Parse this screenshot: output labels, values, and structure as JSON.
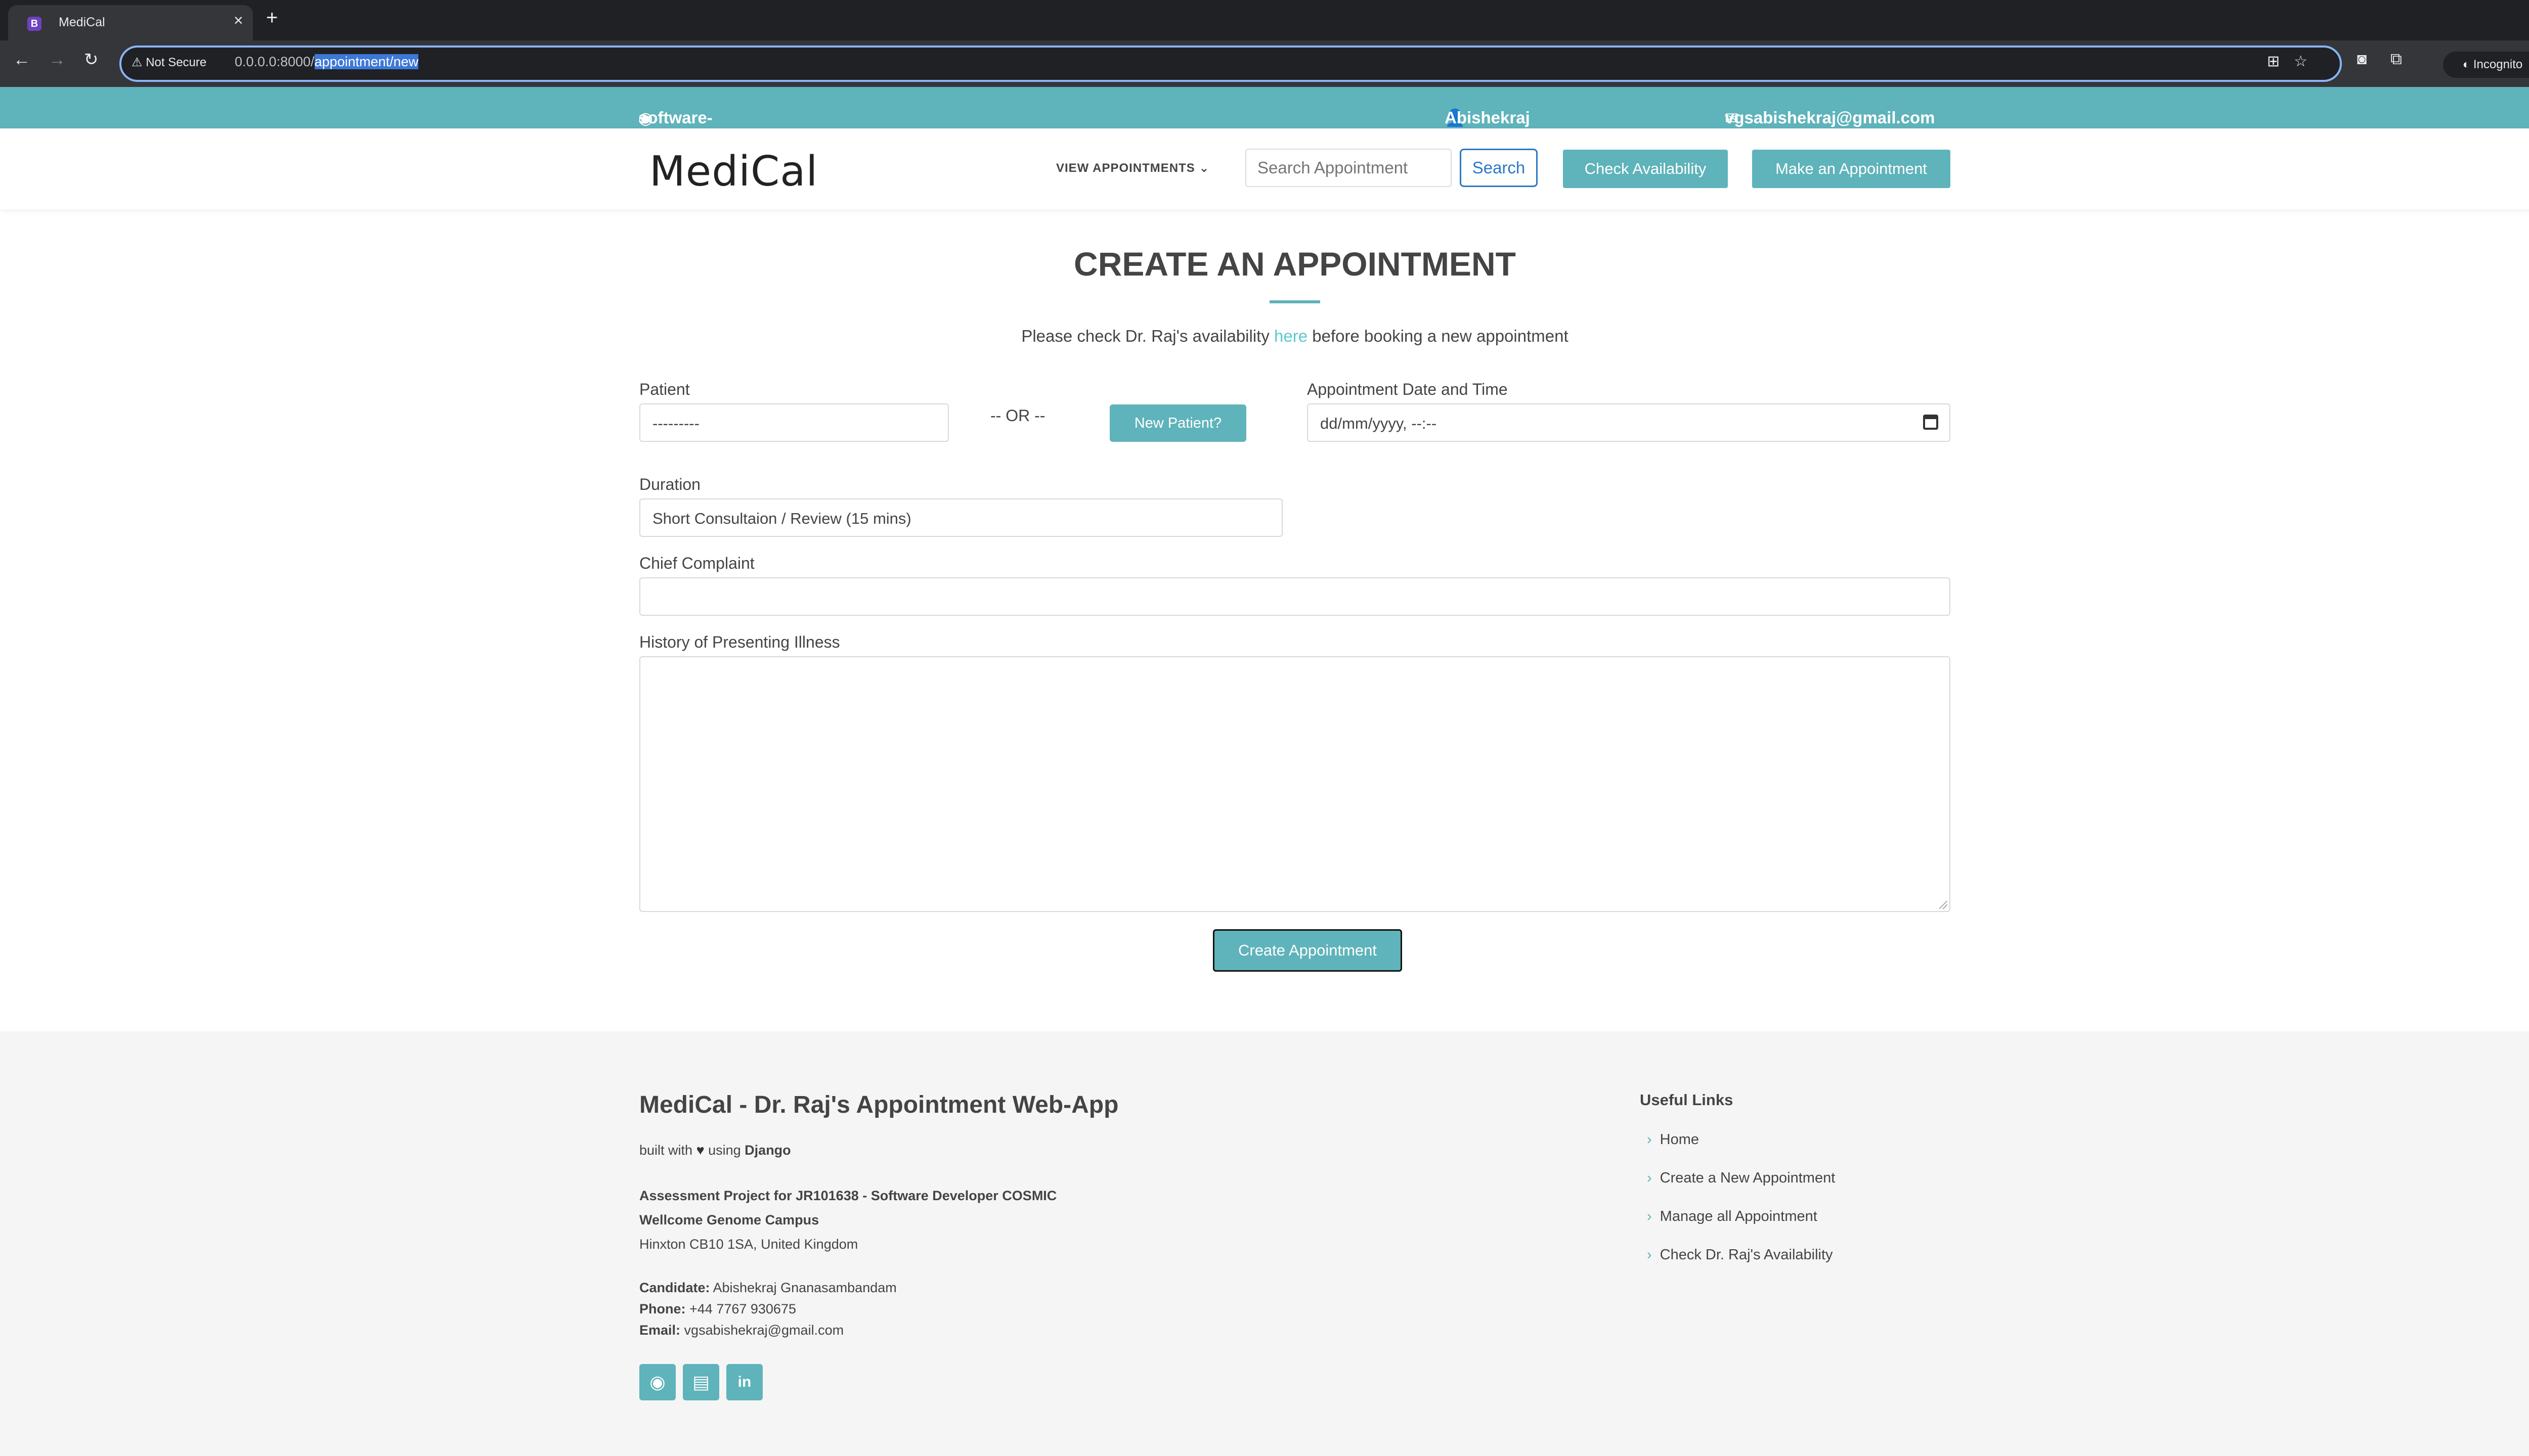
{
  "browser": {
    "tab_title": "MediCal",
    "favicon_letter": "B",
    "not_secure_label": "Not Secure",
    "url_host": "0.0.0.0:8000/",
    "url_path": "appointment/new",
    "incognito_label": "Incognito"
  },
  "topbar": {
    "github_user": "software-developer-backend-abishek",
    "user_name": "Abishekraj Gnanasambandam",
    "user_email": "vgsabishekraj@gmail.com"
  },
  "nav": {
    "logo": "MediCal",
    "view_appointments": "VIEW APPOINTMENTS",
    "search_placeholder": "Search Appointment",
    "search_button": "Search",
    "check_availability": "Check Availability",
    "make_appointment": "Make an Appointment"
  },
  "main": {
    "title": "CREATE AN APPOINTMENT",
    "notice_before": "Please check Dr. Raj's availability",
    "notice_link": "here",
    "notice_after": "before booking a new appointment",
    "patient_label": "Patient",
    "patient_value": "---------",
    "or_text": "-- OR --",
    "new_patient_button": "New Patient?",
    "datetime_label": "Appointment Date and Time",
    "datetime_value": "dd/mm/yyyy, --:--",
    "duration_label": "Duration",
    "duration_value": "Short Consultaion / Review (15 mins)",
    "complaint_label": "Chief Complaint",
    "complaint_value": "",
    "history_label": "History of Presenting Illness",
    "submit_button": "Create Appointment"
  },
  "footer": {
    "title": "MediCal - Dr. Raj's Appointment Web-App",
    "built_prefix": "built with",
    "built_using": "using",
    "built_framework": "Django",
    "project_line": "Assessment Project for JR101638 - Software Developer COSMIC",
    "campus_line": "Wellcome Genome Campus",
    "address_line": "Hinxton CB10 1SA, United Kingdom",
    "candidate_label": "Candidate:",
    "candidate_value": "Abishekraj Gnanasambandam",
    "phone_label": "Phone:",
    "phone_value": "+44 7767 930675",
    "email_label": "Email:",
    "email_value": "vgsabishekraj@gmail.com",
    "useful_links_title": "Useful Links",
    "links": [
      "Home",
      "Create a New Appointment",
      "Manage all Appointment",
      "Check Dr. Raj's Availability"
    ],
    "social_icons": [
      "github-icon",
      "resume-icon",
      "linkedin-icon"
    ]
  },
  "colors": {
    "accent": "#5fb3ba",
    "link": "#5fc8c9",
    "search_blue": "#2b78c5"
  }
}
